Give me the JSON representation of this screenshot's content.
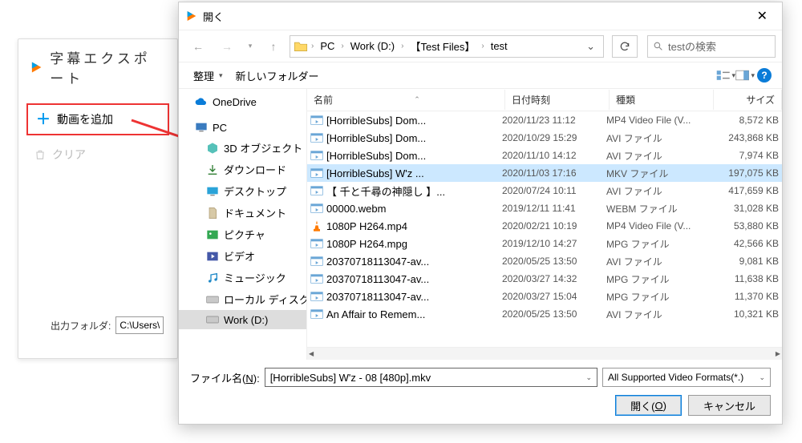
{
  "back_window": {
    "title": "字幕エクスポート",
    "add_video": "動画を追加",
    "clear": "クリア",
    "output_label": "出力フォルダ:",
    "output_value": "C:\\Users\\hu"
  },
  "dialog": {
    "title": "開く",
    "path": [
      "PC",
      "Work (D:)",
      "【Test Files】",
      "test"
    ],
    "search_placeholder": "testの検索",
    "toolbar": {
      "organize": "整理",
      "new_folder": "新しいフォルダー"
    },
    "tree": {
      "onedrive": "OneDrive",
      "pc": "PC",
      "objects3d": "3D オブジェクト",
      "downloads": "ダウンロード",
      "desktop": "デスクトップ",
      "documents": "ドキュメント",
      "pictures": "ピクチャ",
      "videos": "ビデオ",
      "music": "ミュージック",
      "localdisk": "ローカル ディスク (C",
      "workd": "Work (D:)"
    },
    "columns": {
      "name": "名前",
      "date": "日付時刻",
      "type": "種類",
      "size": "サイズ"
    },
    "files": [
      {
        "name": "[HorribleSubs] Dom...",
        "date": "2020/11/23 11:12",
        "type": "MP4 Video File (V...",
        "size": "8,572 KB",
        "icon": "video"
      },
      {
        "name": "[HorribleSubs] Dom...",
        "date": "2020/10/29 15:29",
        "type": "AVI ファイル",
        "size": "243,868 KB",
        "icon": "video"
      },
      {
        "name": "[HorribleSubs] Dom...",
        "date": "2020/11/10 14:12",
        "type": "AVI ファイル",
        "size": "7,974 KB",
        "icon": "video"
      },
      {
        "name": "[HorribleSubs] W'z ...",
        "date": "2020/11/03 17:16",
        "type": "MKV ファイル",
        "size": "197,075 KB",
        "icon": "video",
        "selected": true
      },
      {
        "name": "【 千と千尋の神隠し 】...",
        "date": "2020/07/24 10:11",
        "type": "AVI ファイル",
        "size": "417,659 KB",
        "icon": "video"
      },
      {
        "name": "00000.webm",
        "date": "2019/12/11 11:41",
        "type": "WEBM ファイル",
        "size": "31,028 KB",
        "icon": "video"
      },
      {
        "name": "1080P H264.mp4",
        "date": "2020/02/21 10:19",
        "type": "MP4 Video File (V...",
        "size": "53,880 KB",
        "icon": "vlc"
      },
      {
        "name": "1080P H264.mpg",
        "date": "2019/12/10 14:27",
        "type": "MPG ファイル",
        "size": "42,566 KB",
        "icon": "video"
      },
      {
        "name": "20370718113047-av...",
        "date": "2020/05/25 13:50",
        "type": "AVI ファイル",
        "size": "9,081 KB",
        "icon": "video"
      },
      {
        "name": "20370718113047-av...",
        "date": "2020/03/27 14:32",
        "type": "MPG ファイル",
        "size": "11,638 KB",
        "icon": "video"
      },
      {
        "name": "20370718113047-av...",
        "date": "2020/03/27 15:04",
        "type": "MPG ファイル",
        "size": "11,370 KB",
        "icon": "video"
      },
      {
        "name": "An Affair to Remem...",
        "date": "2020/05/25 13:50",
        "type": "AVI ファイル",
        "size": "10,321 KB",
        "icon": "video"
      }
    ],
    "filename_label_pre": "ファイル名(",
    "filename_label_u": "N",
    "filename_label_post": "):",
    "filename_value": "[HorribleSubs] W'z - 08 [480p].mkv",
    "filter_value": "All Supported Video Formats(*.)",
    "open_btn_pre": "開く(",
    "open_btn_u": "O",
    "open_btn_post": ")",
    "cancel_btn": "キャンセル"
  }
}
